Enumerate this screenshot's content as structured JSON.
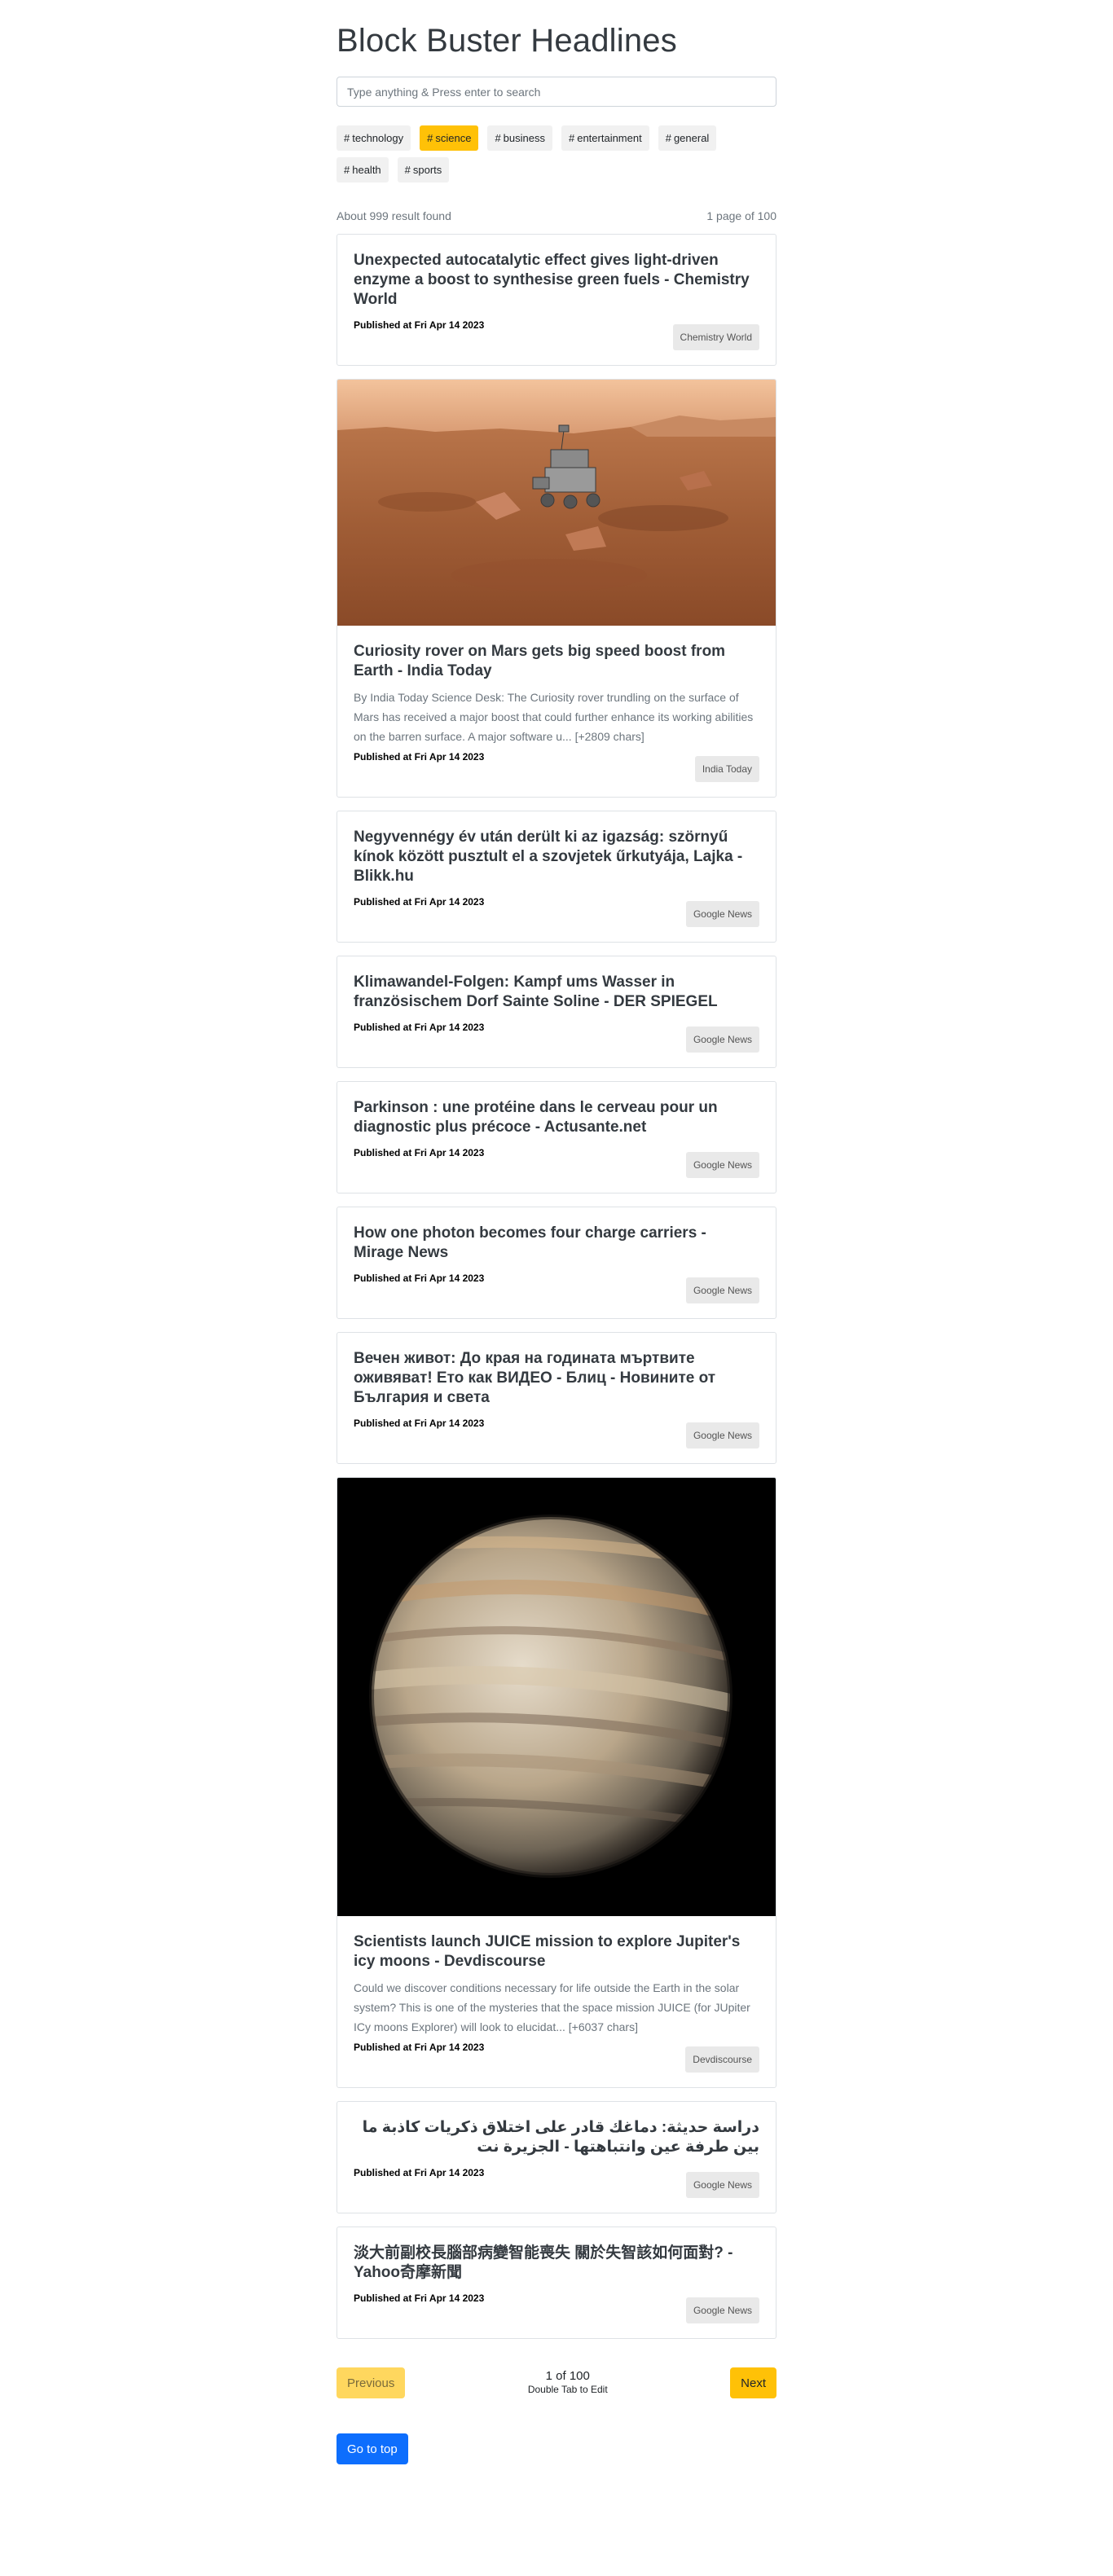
{
  "header": {
    "title": "Block Buster Headlines"
  },
  "search": {
    "placeholder": "Type anything & Press enter to search"
  },
  "tags": [
    {
      "label": "technology",
      "active": false
    },
    {
      "label": "science",
      "active": true
    },
    {
      "label": "business",
      "active": false
    },
    {
      "label": "entertainment",
      "active": false
    },
    {
      "label": "general",
      "active": false
    },
    {
      "label": "health",
      "active": false
    },
    {
      "label": "sports",
      "active": false
    }
  ],
  "results": {
    "count_text": "About 999 result found",
    "page_text": "1 page of 100"
  },
  "articles": [
    {
      "title": "Unexpected autocatalytic effect gives light-driven enzyme a boost to synthesise green fuels - Chemistry World",
      "published": "Published at Fri Apr 14 2023",
      "source": "Chemistry World"
    },
    {
      "title": "Curiosity rover on Mars gets big speed boost from Earth - India Today",
      "description": "By India Today Science Desk: The Curiosity rover trundling on the surface of Mars has received a major boost that could further enhance its working abilities on the barren surface. A major software u... [+2809 chars]",
      "published": "Published at Fri Apr 14 2023",
      "source": "India Today",
      "image": "mars-rover-photo"
    },
    {
      "title": "Negyvennégy év után derült ki az igazság: szörnyű kínok között pusztult el a szovjetek űrkutyája, Lajka - Blikk.hu",
      "published": "Published at Fri Apr 14 2023",
      "source": "Google News"
    },
    {
      "title": "Klimawandel-Folgen: Kampf ums Wasser in französischem Dorf Sainte Soline - DER SPIEGEL",
      "published": "Published at Fri Apr 14 2023",
      "source": "Google News"
    },
    {
      "title": "Parkinson : une protéine dans le cerveau pour un diagnostic plus précoce - Actusante.net",
      "published": "Published at Fri Apr 14 2023",
      "source": "Google News"
    },
    {
      "title": "How one photon becomes four charge carriers - Mirage News",
      "published": "Published at Fri Apr 14 2023",
      "source": "Google News"
    },
    {
      "title": "Вечен живот: До края на годината мъртвите оживяват! Ето как ВИДЕО - Блиц - Новините от България и света",
      "published": "Published at Fri Apr 14 2023",
      "source": "Google News"
    },
    {
      "title": "Scientists launch JUICE mission to explore Jupiter's icy moons - Devdiscourse",
      "description": "Could we discover conditions necessary for life outside the Earth in the solar system? This is one of the mysteries that the space mission JUICE (for JUpiter ICy moons Explorer) will look to elucidat... [+6037 chars]",
      "published": "Published at Fri Apr 14 2023",
      "source": "Devdiscourse",
      "image": "jupiter-photo"
    },
    {
      "title": "دراسة حديثة: دماغك قادر على اختلاق ذكريات كاذبة ما بين طرفة عين وانتباهتها - الجزيرة نت",
      "published": "Published at Fri Apr 14 2023",
      "source": "Google News",
      "rtl": true
    },
    {
      "title": "淡大前副校長腦部病變智能喪失 關於失智該如何面對? - Yahoo奇摩新聞",
      "published": "Published at Fri Apr 14 2023",
      "source": "Google News"
    }
  ],
  "pagination": {
    "prev_label": "Previous",
    "next_label": "Next",
    "page_count": "1 of 100",
    "hint": "Double Tab to Edit"
  },
  "footer": {
    "top_label": "Go to top"
  },
  "colors": {
    "accent": "#ffc107",
    "primary": "#0d6efd"
  }
}
